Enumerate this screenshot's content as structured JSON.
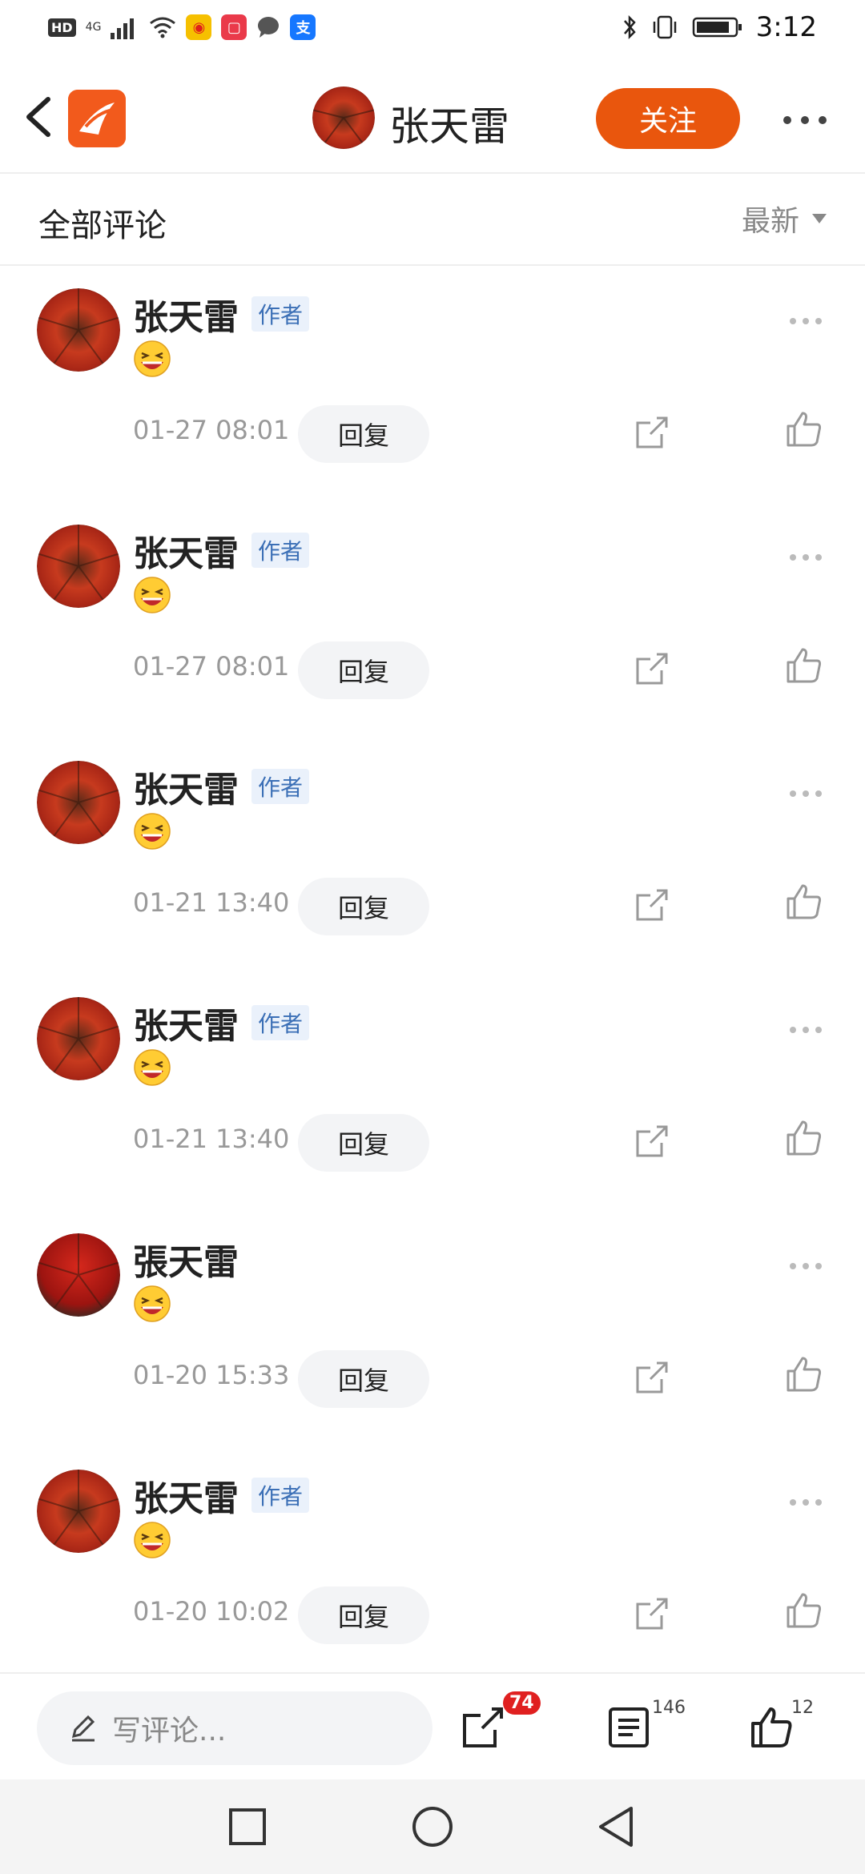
{
  "status_bar": {
    "hd": "HD",
    "network": "4G",
    "time": "3:12",
    "icons": [
      "signal-icon",
      "wifi-icon",
      "weibo-icon",
      "app-icon",
      "message-icon",
      "alipay-icon",
      "bluetooth-icon",
      "vibrate-icon",
      "battery-icon"
    ]
  },
  "header": {
    "author_name": "张天雷",
    "follow_label": "关注"
  },
  "section": {
    "title": "全部评论",
    "sort_label": "最新"
  },
  "comments": [
    {
      "name": "张天雷",
      "badge": "作者",
      "time": "01-27 08:01",
      "reply": "回复"
    },
    {
      "name": "张天雷",
      "badge": "作者",
      "time": "01-27 08:01",
      "reply": "回复"
    },
    {
      "name": "张天雷",
      "badge": "作者",
      "time": "01-21 13:40",
      "reply": "回复"
    },
    {
      "name": "张天雷",
      "badge": "作者",
      "time": "01-21 13:40",
      "reply": "回复"
    },
    {
      "name": "張天雷",
      "badge": "",
      "time": "01-20 15:33",
      "reply": "回复"
    },
    {
      "name": "张天雷",
      "badge": "作者",
      "time": "01-20 10:02",
      "reply": "回复"
    }
  ],
  "bottom_bar": {
    "write_placeholder": "写评论...",
    "share_count": "74",
    "comment_count": "146",
    "like_count": "12"
  },
  "colors": {
    "accent": "#e9560d",
    "badge_bg": "#eaf1fb",
    "badge_text": "#3b6fb6",
    "red_badge": "#e02020"
  }
}
